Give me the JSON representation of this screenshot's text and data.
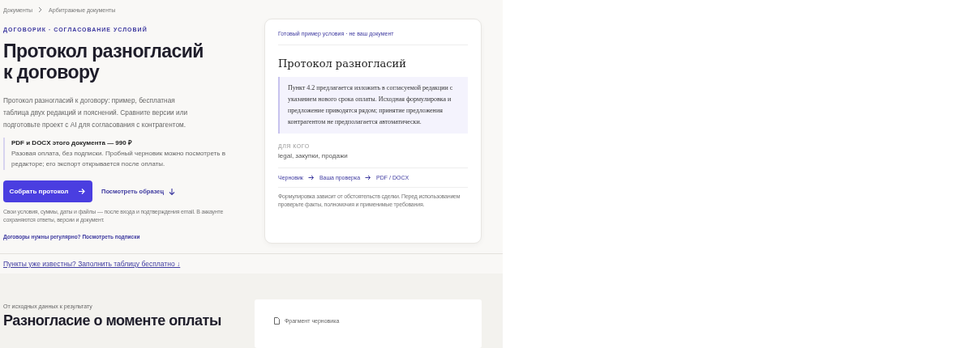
{
  "breadcrumbs": [
    {
      "label": "Документы"
    },
    {
      "label": "Арбитражные документы"
    }
  ],
  "eyebrow": "ДОГОВОРИК · СОГЛАСОВАНИЕ УСЛОВИЙ",
  "title": "Протокол разногласий к договору",
  "intro": "Протокол разногласий к договору: пример, бесплатная таблица двух редакций и пояснений. Сравните версии или подготовьте проект с AI для согласования с контрагентом.",
  "price": {
    "title": "PDF и DOCX этого документа — 990 ₽",
    "text": "Разовая оплата, без подписки. Пробный черновик можно посмотреть в редакторе; его экспорт открывается после оплаты."
  },
  "primary_button": "Собрать протокол",
  "sample_link": "Посмотреть образец",
  "note": "Свои условия, суммы, даты и файлы — после входа и подтверждения email. В аккаунте сохраняются ответы, версии и документ.",
  "subscription_link": "Договоры нужны регулярно? Посмотреть подписки",
  "example_card": {
    "badge": "Готовый пример условия · не ваш документ",
    "title": "Протокол разногласий",
    "quote": "Пункт 4.2 предлагается изложить в согласуемой редакции с указанием нового срока оплаты. Исходная формулировка и предложение приводятся рядом; принятие предложения контрагентом не предполагается автоматически.",
    "audience_label": "ДЛЯ КОГО",
    "audience": "legal, закупки, продажи",
    "steps": [
      "Черновик",
      "Ваша проверка",
      "PDF / DOCX"
    ],
    "disclaimer": "Формулировка зависит от обстоятельств сделки. Перед использованием проверьте факты, полномочия и применимые требования."
  },
  "table_link": "Пункты уже известны? Заполнить таблицу бесплатно ↓",
  "section": {
    "eyebrow": "От исходных данных к результату",
    "title": "Разногласие о моменте оплаты",
    "card_label": "Фрагмент черновика"
  }
}
